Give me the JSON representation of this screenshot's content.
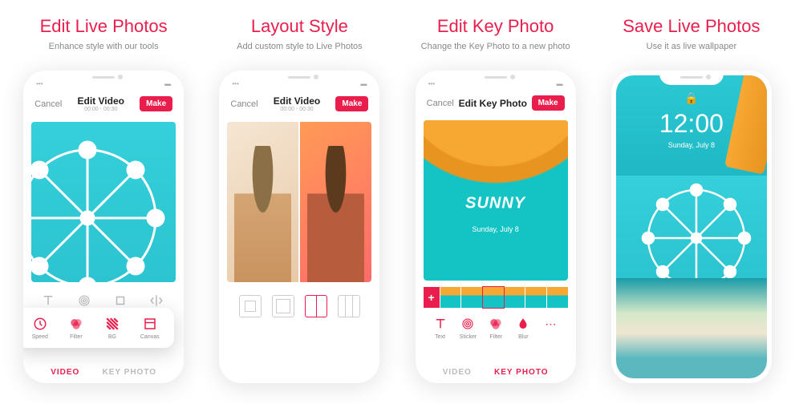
{
  "cards": [
    {
      "title": "Edit Live Photos",
      "sub": "Enhance style with our tools"
    },
    {
      "title": "Layout Style",
      "sub": "Add custom style to Live Photos"
    },
    {
      "title": "Edit Key Photo",
      "sub": "Change the Key Photo to a new photo"
    },
    {
      "title": "Save Live Photos",
      "sub": "Use it as live wallpaper"
    }
  ],
  "nav": {
    "cancel": "Cancel",
    "editVideo": "Edit Video",
    "editKey": "Edit Key Photo",
    "range": "00:00 - 00:30",
    "make": "Make"
  },
  "popup": [
    {
      "name": "speed",
      "label": "Speed"
    },
    {
      "name": "filter",
      "label": "Filter"
    },
    {
      "name": "bg",
      "label": "BG"
    },
    {
      "name": "canvas",
      "label": "Canvas"
    }
  ],
  "tabs": {
    "video": "VIDEO",
    "key": "KEY PHOTO"
  },
  "sunny": {
    "title": "SUNNY",
    "date": "Sunday, July 8"
  },
  "keyTools": [
    {
      "name": "text",
      "label": "Text"
    },
    {
      "name": "sticker",
      "label": "Sticker"
    },
    {
      "name": "filter",
      "label": "Filter"
    },
    {
      "name": "blur",
      "label": "Blur"
    }
  ],
  "lock": {
    "time": "12:00",
    "date": "Sunday, July 8"
  },
  "plus": "+"
}
